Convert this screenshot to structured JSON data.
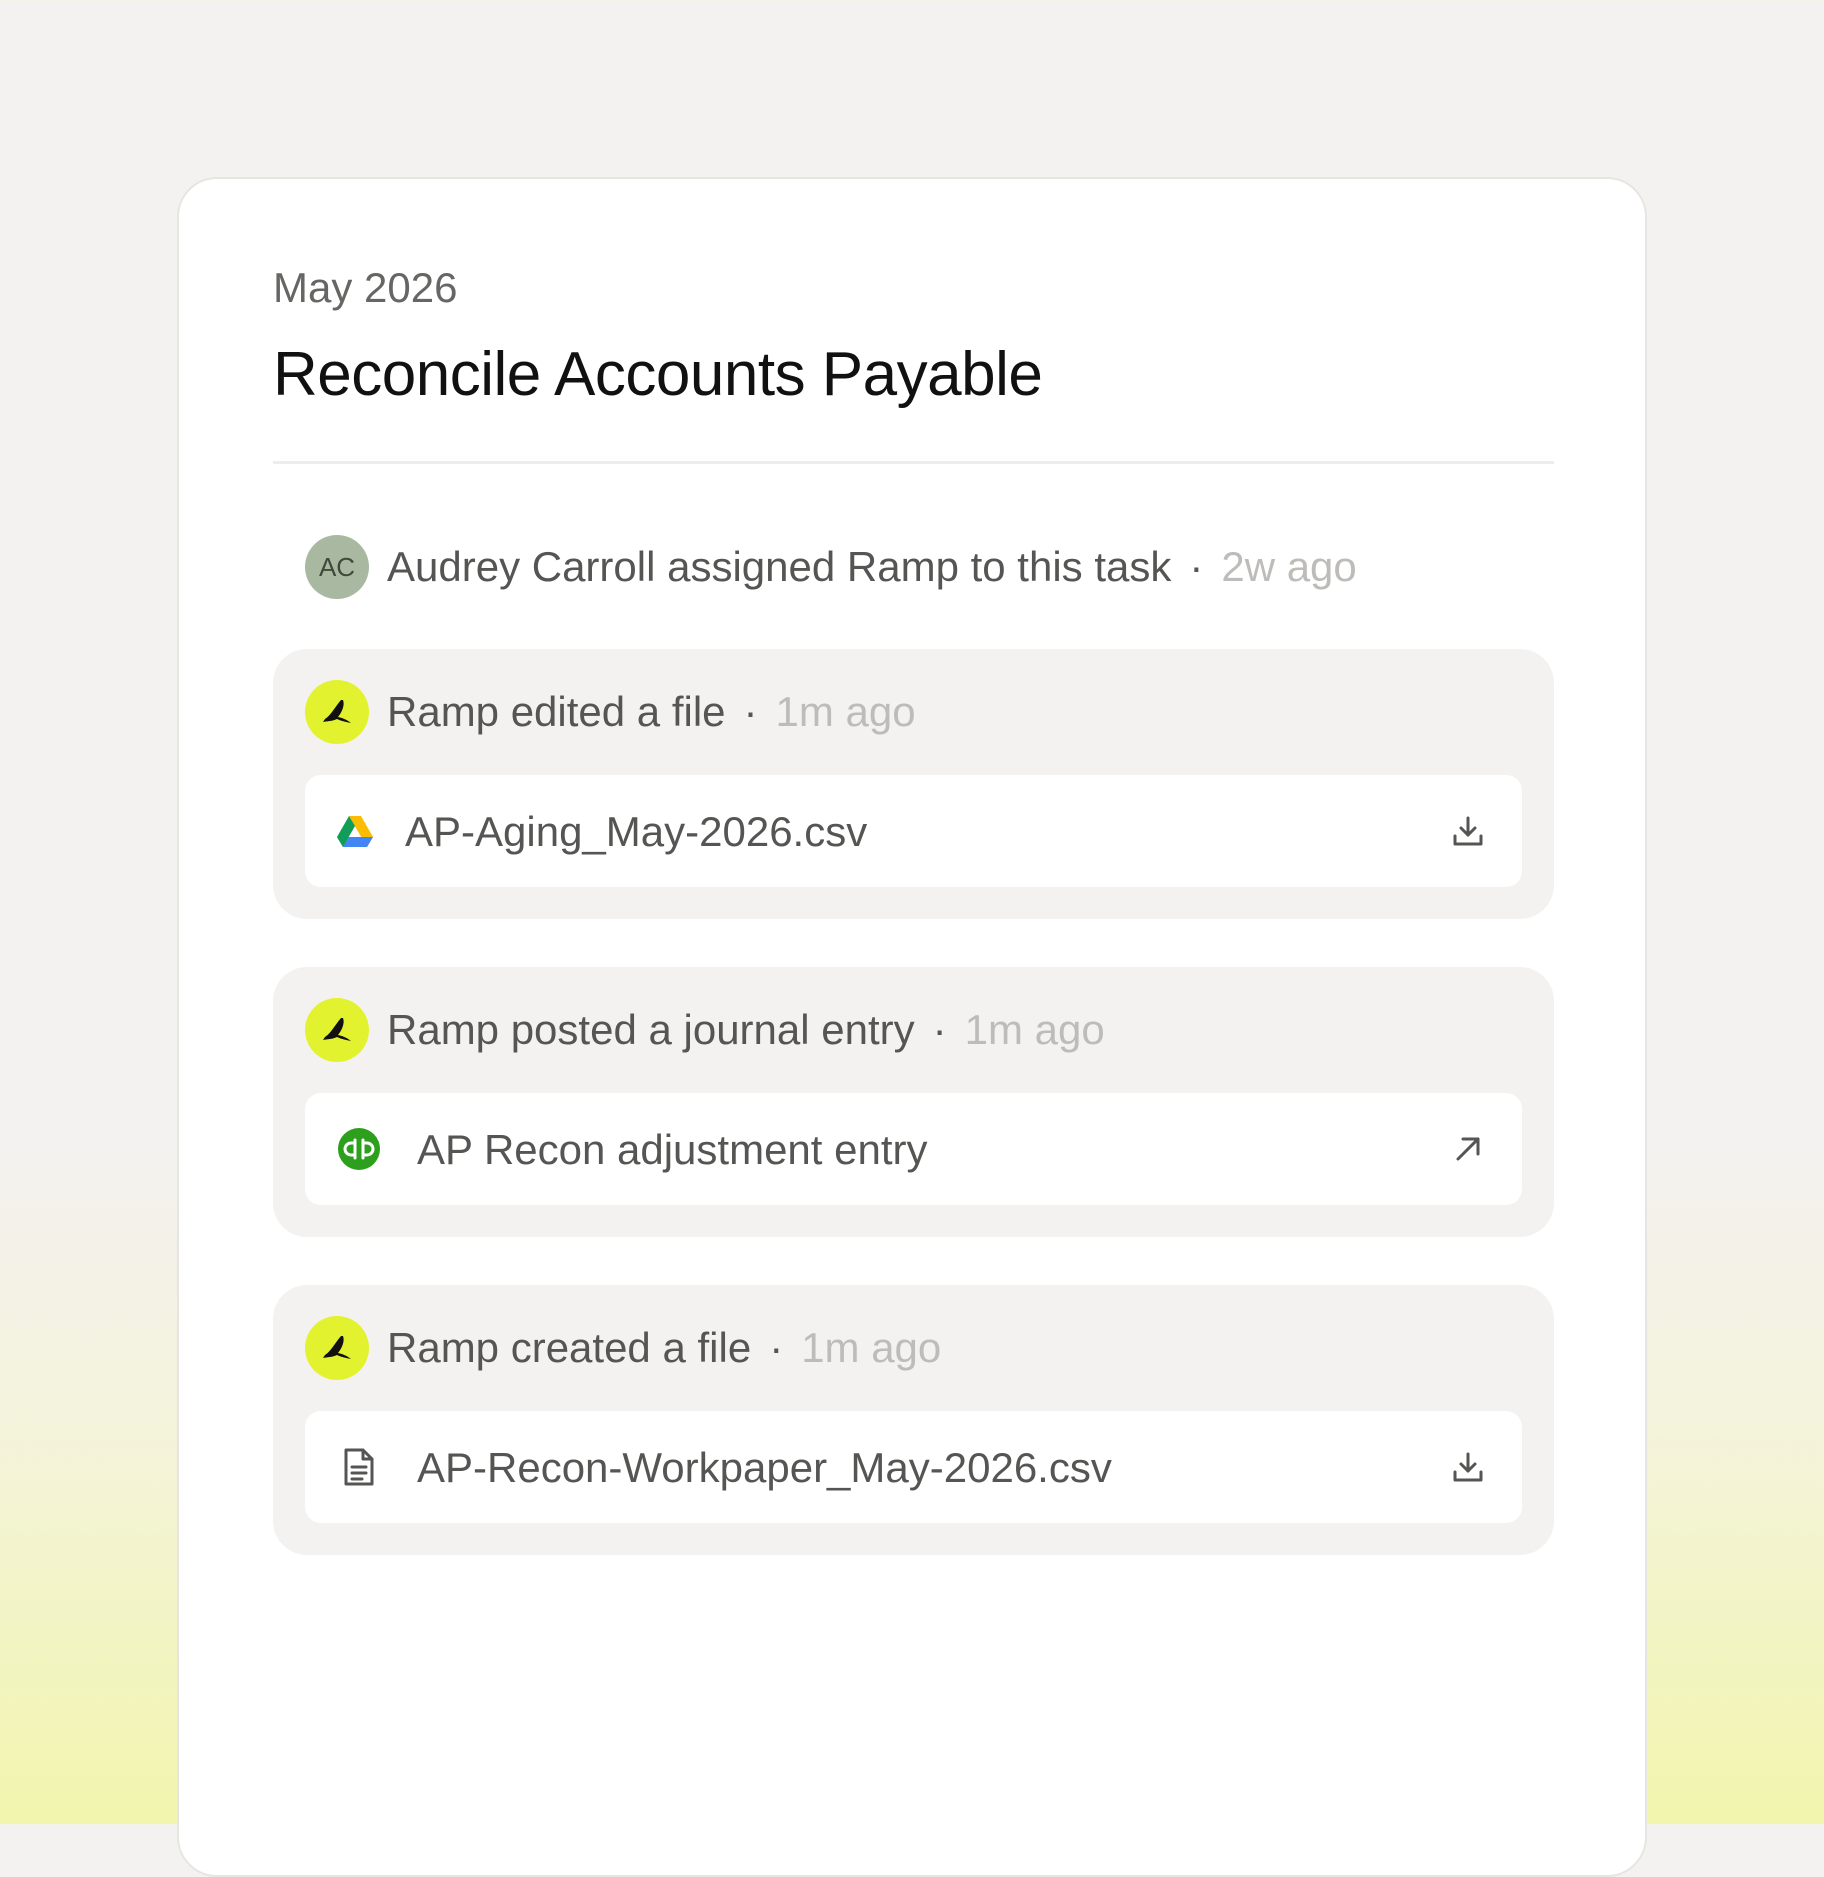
{
  "header": {
    "period": "May 2026",
    "title": "Reconcile Accounts Payable"
  },
  "assignment": {
    "avatar_initials": "AC",
    "text": "Audrey Carroll assigned Ramp to this task",
    "separator": "·",
    "time": "2w ago"
  },
  "activities": [
    {
      "actor_icon": "ramp-logo-icon",
      "text": "Ramp edited a file",
      "separator": "·",
      "time": "1m ago",
      "item": {
        "name": "AP-Aging_May-2026.csv",
        "icon": "google-drive-icon",
        "action_icon": "download-icon"
      }
    },
    {
      "actor_icon": "ramp-logo-icon",
      "text": "Ramp posted a journal entry",
      "separator": "·",
      "time": "1m ago",
      "item": {
        "name": "AP Recon adjustment entry",
        "icon": "quickbooks-icon",
        "action_icon": "external-link-icon"
      }
    },
    {
      "actor_icon": "ramp-logo-icon",
      "text": "Ramp created a file",
      "separator": "·",
      "time": "1m ago",
      "item": {
        "name": "AP-Recon-Workpaper_May-2026.csv",
        "icon": "document-icon",
        "action_icon": "download-icon"
      }
    }
  ],
  "colors": {
    "ramp_accent": "#e3f22e",
    "quickbooks_green": "#2ca01c",
    "avatar_ac_bg": "#a9b9a1"
  }
}
